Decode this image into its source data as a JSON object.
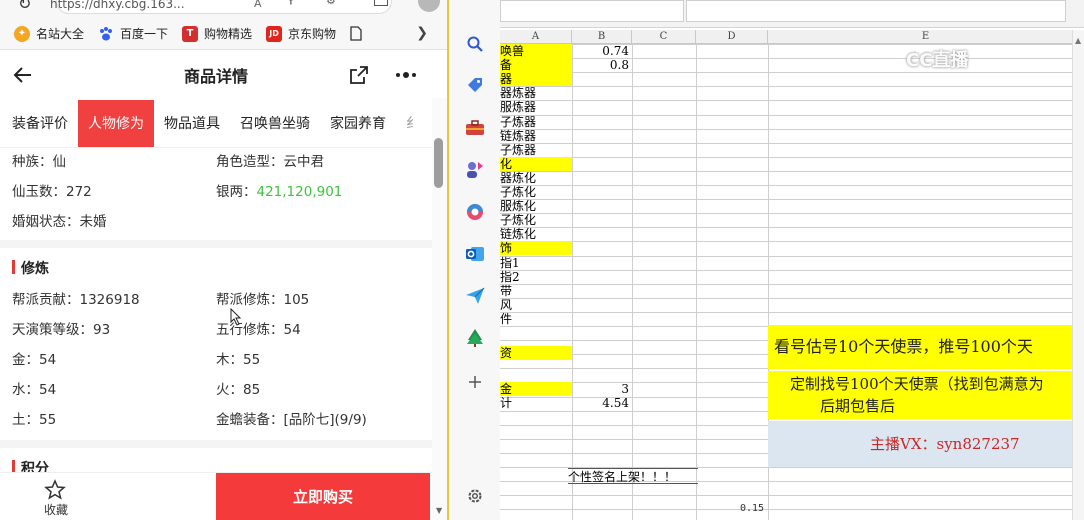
{
  "browser": {
    "url": "https://dhxy.cbg.163...",
    "reader_mode": "A",
    "bookmarks": [
      {
        "label": "名站大全",
        "icon": "compass-icon",
        "color": "#f5a623"
      },
      {
        "label": "百度一下",
        "icon": "baidu-paw-icon",
        "color": "#3061f2"
      },
      {
        "label": "购物精选",
        "icon": "t-logo-icon",
        "color": "#d32f2f"
      },
      {
        "label": "京东购物",
        "icon": "jd-logo-icon",
        "color": "#e1251b"
      }
    ],
    "t_logo": "T",
    "jd_logo": "JD"
  },
  "page": {
    "title": "商品详情",
    "tabs": [
      "装备评价",
      "人物修为",
      "物品道具",
      "召唤兽坐骑",
      "家园养育",
      "纟"
    ],
    "active_tab": "人物修为",
    "basic": [
      {
        "k1": "种族：",
        "v1": "仙",
        "k2": "角色造型：",
        "v2": "云中君"
      },
      {
        "k1": "仙玉数：",
        "v1": "272",
        "k2": "银两：",
        "v2": "421,120,901"
      },
      {
        "k1": "婚姻状态：",
        "v1": "未婚",
        "k2": "",
        "v2": ""
      }
    ],
    "section_cultivation": "修炼",
    "cultivation": [
      {
        "k1": "帮派贡献：",
        "v1": "1326918",
        "k2": "帮派修炼：",
        "v2": "105"
      },
      {
        "k1": "天演策等级：",
        "v1": "93",
        "k2": "五行修炼：",
        "v2": "54"
      },
      {
        "k1": "金：",
        "v1": "54",
        "k2": "木：",
        "v2": "55"
      },
      {
        "k1": "水：",
        "v1": "54",
        "k2": "火：",
        "v2": "85"
      },
      {
        "k1": "土：",
        "v1": "55",
        "k2": "金蟾装备：",
        "v2": "[品阶七](9/9)"
      }
    ],
    "section_points": "积分",
    "favorite_label": "收藏",
    "buy_label": "立即购买"
  },
  "sheet": {
    "columns": [
      "A",
      "B",
      "C",
      "D",
      "E"
    ],
    "rows": [
      {
        "a": "唤兽",
        "b": "0.74",
        "yellow": true
      },
      {
        "a": "备",
        "b": "0.8",
        "yellow": true
      },
      {
        "a": "器",
        "b": "",
        "yellow": true
      },
      {
        "a": "器炼器",
        "b": "",
        "yellow": false
      },
      {
        "a": "服炼器",
        "b": "",
        "yellow": false
      },
      {
        "a": "子炼器",
        "b": "",
        "yellow": false
      },
      {
        "a": "链炼器",
        "b": "",
        "yellow": false
      },
      {
        "a": "子炼器",
        "b": "",
        "yellow": false
      },
      {
        "a": "化",
        "b": "",
        "yellow": true
      },
      {
        "a": "器炼化",
        "b": "",
        "yellow": false
      },
      {
        "a": "子炼化",
        "b": "",
        "yellow": false
      },
      {
        "a": "服炼化",
        "b": "",
        "yellow": false
      },
      {
        "a": "子炼化",
        "b": "",
        "yellow": false
      },
      {
        "a": "链炼化",
        "b": "",
        "yellow": false
      },
      {
        "a": "饰",
        "b": "",
        "yellow": true
      },
      {
        "a": "指1",
        "b": "",
        "yellow": false
      },
      {
        "a": "指2",
        "b": "",
        "yellow": false
      },
      {
        "a": "带",
        "b": "",
        "yellow": false
      },
      {
        "a": "风",
        "b": "",
        "yellow": false
      },
      {
        "a": "件",
        "b": "",
        "yellow": false
      },
      {
        "a": "",
        "b": "",
        "yellow": false
      },
      {
        "a": "资",
        "b": "",
        "yellow": true
      },
      {
        "a": "",
        "b": "",
        "yellow": false
      },
      {
        "a": "金",
        "b": "3",
        "yellow": true
      },
      {
        "a": "计",
        "b": "4.54",
        "yellow": false
      }
    ],
    "marquee": "个性签名上架！！！",
    "small_value": "0.15",
    "banner1": "看号估号10个天使票，推号100个天",
    "banner2_line1": "定制找号100个天使票（找到包满意为",
    "banner2_line2": "后期包售后",
    "contact": "主播VX：syn827237",
    "watermark": "CC直播"
  },
  "colors": {
    "accent_red": "#f04040",
    "buy_red": "#f43a3a",
    "silver_green": "#3ec43e",
    "sheet_yellow": "#ffff00",
    "contact_bg": "#dce6f1"
  }
}
